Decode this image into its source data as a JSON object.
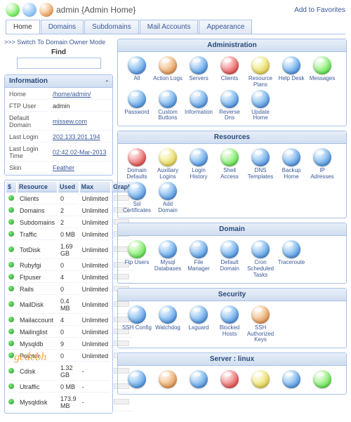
{
  "header": {
    "title": "admin {Admin Home}",
    "add_fav": "Add to Favorites"
  },
  "tabs": [
    "Home",
    "Domains",
    "Subdomains",
    "Mail Accounts",
    "Appearance"
  ],
  "switch_link": ">>> Switch To Domain Owner Mode",
  "find": {
    "label": "Find",
    "placeholder": ""
  },
  "info": {
    "title": "Information",
    "dash": "-",
    "rows": [
      {
        "k": "Home",
        "v": "/home/admin/",
        "link": true
      },
      {
        "k": "FTP User",
        "v": "admin"
      },
      {
        "k": "Default Domain",
        "v": "missew.com",
        "link": true
      },
      {
        "k": "Last Login",
        "v": "202.133.201.194",
        "link": true
      },
      {
        "k": "Last Login Time",
        "v": "02:42.02-Mar-2013",
        "link": true
      },
      {
        "k": "Skin",
        "v": "Feather",
        "link": true
      }
    ]
  },
  "resources": {
    "headers": [
      "$",
      "Resource",
      "Used",
      "Max",
      "Graph"
    ],
    "rows": [
      {
        "r": "Clients",
        "u": "0",
        "m": "Unlimited"
      },
      {
        "r": "Domains",
        "u": "2",
        "m": "Unlimited"
      },
      {
        "r": "Subdomains",
        "u": "2",
        "m": "Unlimited"
      },
      {
        "r": "Traffic",
        "u": "0 MB",
        "m": "Unlimited"
      },
      {
        "r": "TotDisk",
        "u": "1.69 GB",
        "m": "Unlimited"
      },
      {
        "r": "Rubyfgi",
        "u": "0",
        "m": "Unlimited"
      },
      {
        "r": "Ftpuser",
        "u": "4",
        "m": "Unlimited"
      },
      {
        "r": "Rails",
        "u": "0",
        "m": "Unlimited"
      },
      {
        "r": "MailDisk",
        "u": "0.4 MB",
        "m": "Unlimited"
      },
      {
        "r": "Mailaccount",
        "u": "4",
        "m": "Unlimited"
      },
      {
        "r": "Mailinglist",
        "u": "0",
        "m": "Unlimited"
      },
      {
        "r": "Mysqldb",
        "u": "9",
        "m": "Unlimited"
      },
      {
        "r": "Pointer",
        "u": "0",
        "m": "Unlimited"
      },
      {
        "r": "Cdisk",
        "u": "1.32 GB",
        "m": "-"
      },
      {
        "r": "Utraffic",
        "u": "0 MB",
        "m": "-"
      },
      {
        "r": "Mysqldisk",
        "u": "173.9 MB",
        "m": "-"
      }
    ]
  },
  "sections": [
    {
      "title": "Administration",
      "items": [
        "All",
        "Action Logs",
        "Servers",
        "Clients",
        "Resource Plans",
        "Help Desk",
        "Messages",
        "Password",
        "Custom Buttons",
        "Information",
        "Reverse Dns",
        "Update Home"
      ]
    },
    {
      "title": "Resources",
      "items": [
        "Domain Defaults",
        "Auxiliary Logins",
        "Login History",
        "Shell Access",
        "DNS Templates",
        "Backup Home",
        "IP Adresses",
        "Ssl Certificates",
        "Add Domain"
      ]
    },
    {
      "title": "Domain",
      "items": [
        "Ftp Users",
        "Mysql Databases",
        "File Manager",
        "Default Domain",
        "Cron Scheduled Tasks",
        "Traceroute"
      ]
    },
    {
      "title": "Security",
      "items": [
        "SSH Config",
        "Watchdog",
        "Lxguard",
        "Blocked Hosts",
        "SSH Authorized Keys"
      ]
    },
    {
      "title": "Server : linux",
      "items": [
        "",
        "",
        "",
        "",
        "",
        "",
        ""
      ]
    }
  ],
  "watermark": "gedebh"
}
